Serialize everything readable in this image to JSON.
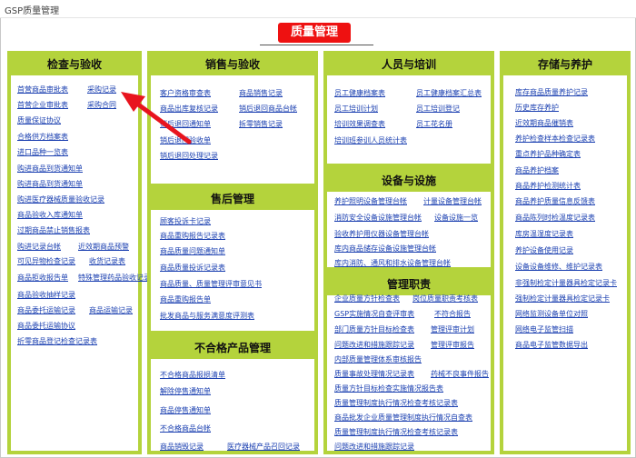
{
  "window": {
    "title": "GSP质量管理"
  },
  "page": {
    "title": "质量管理"
  },
  "panels": {
    "inspection": {
      "title": "检查与验收",
      "links": [
        "首营商品审批表",
        "采购记录",
        "首营企业审批表",
        "采购合同",
        "质量保证协议",
        "合格供方档案表",
        "进口品种一览表",
        "购进商品到货通知单",
        "购进商品到货通知单",
        "购进医疗器械质量验收记录",
        "商品验收入库通知单",
        "过期商品禁止销售报表",
        "购进记录台帐",
        "近效期商品预警",
        "可见异物检查记录",
        "收货记录表",
        "商品拒收报告单",
        "特殊管理药品验收记录",
        "商品验收抽样记录",
        "商品委托运输记录",
        "商品运输记录",
        "商品委托运输协议",
        "折零商品登记检查记录表"
      ]
    },
    "sales": {
      "title": "销售与验收",
      "links": [
        "客户资格审查表",
        "商品销售记录",
        "商品出库复核记录",
        "销后退回商品台帐",
        "销后退回通知单",
        "拆零销售记录",
        "销后退回验收单",
        "销后退回处理记录"
      ]
    },
    "after_sales": {
      "title": "售后管理",
      "links": [
        "顾客投诉卡记录",
        "商品重购报告记录表",
        "商品质量问题通知单",
        "商品质量投诉记录表",
        "商品质量、质量管理评审意见书",
        "商品重购报告单",
        "批发商品与服务满意度评测表"
      ]
    },
    "nonconforming": {
      "title": "不合格产品管理",
      "links": [
        "不合格商品报损清单",
        "解除停售通知单",
        "商品停售通知单",
        "不合格商品台帐",
        "商品销毁记录",
        "医疗器械产品召回记录"
      ]
    },
    "personnel": {
      "title": "人员与培训",
      "links": [
        "员工健康档案表",
        "员工健康档案汇总表",
        "员工培训计划",
        "员工培训登记",
        "培训效果调查表",
        "员工花名册",
        "培训班参训人员统计表"
      ]
    },
    "equipment": {
      "title": "设备与设施",
      "links": [
        "养护照明设备管理台帐",
        "计量设备管理台帐",
        "消防安全设备设施管理台帐",
        "设备设施一览",
        "验收养护用仪器设备管理台帐",
        "库内商品储存设备设施管理台帐",
        "库内消防、通风和排水设备管理台帐"
      ]
    },
    "management": {
      "title": "管理职责",
      "links": [
        "企业质量方针检查表",
        "岗位质量职责考核表",
        "GSP实施情况自查评审表",
        "不符合报告",
        "部门质量方针目标检查表",
        "管理评审计划",
        "问题改进和措施跟踪记录",
        "管理评审报告",
        "内部质量管理体系审核报告",
        "质量事故处理情况记录表",
        "药械不良事件报告",
        "质量方针目标检查实施情况报告表",
        "质量管理制度执行情况检查考核记录表",
        "商品批发企业质量管理制度执行情况自查表",
        "质量管理制度执行情况检查考核记录表",
        "问题改进和措施跟踪记录"
      ]
    },
    "storage": {
      "title": "存储与养护",
      "links": [
        "库存商品质量养护记录",
        "历史库存养护",
        "近效期商品催销表",
        "养护检查样本检查记录表",
        "重点养护品种确定表",
        "商品养护档案",
        "商品养护检测统计表",
        "商品养护质量信息反馈表",
        "商品陈列时检温度记录表",
        "库房温湿度记录表",
        "养护设备使用记录",
        "设备设备维修、维护记录表",
        "非强制检定计量器具检定记录卡",
        "强制检定计量器具检定记录卡",
        "网络监测设备单位对照",
        "网络电子监管扫描",
        "商品电子监管数据导出"
      ]
    }
  }
}
